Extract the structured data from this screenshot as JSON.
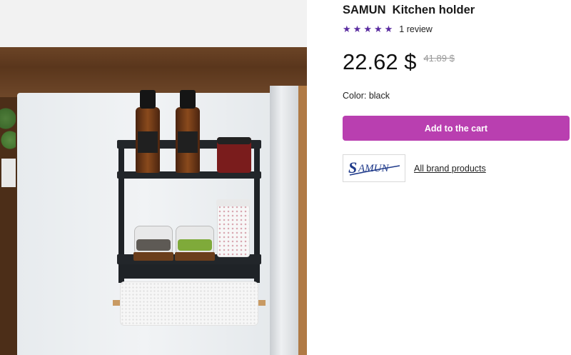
{
  "product": {
    "brand": "SAMUN",
    "name": "Kitchen holder",
    "rating": {
      "stars": 5,
      "max": 5,
      "review_count_label": "1 review"
    },
    "price": {
      "current": "22.62 $",
      "old": "41.89 $"
    },
    "color_label": "Color: black",
    "add_to_cart_label": "Add to the cart",
    "brand_logo_text": "SAMUN",
    "brand_products_link": "All brand products"
  },
  "colors": {
    "accent": "#b93fb0",
    "star": "#5a2ca0",
    "old_price": "#9a9a9a"
  },
  "icons": {
    "star": "star-icon",
    "logo": "brand-logo"
  }
}
